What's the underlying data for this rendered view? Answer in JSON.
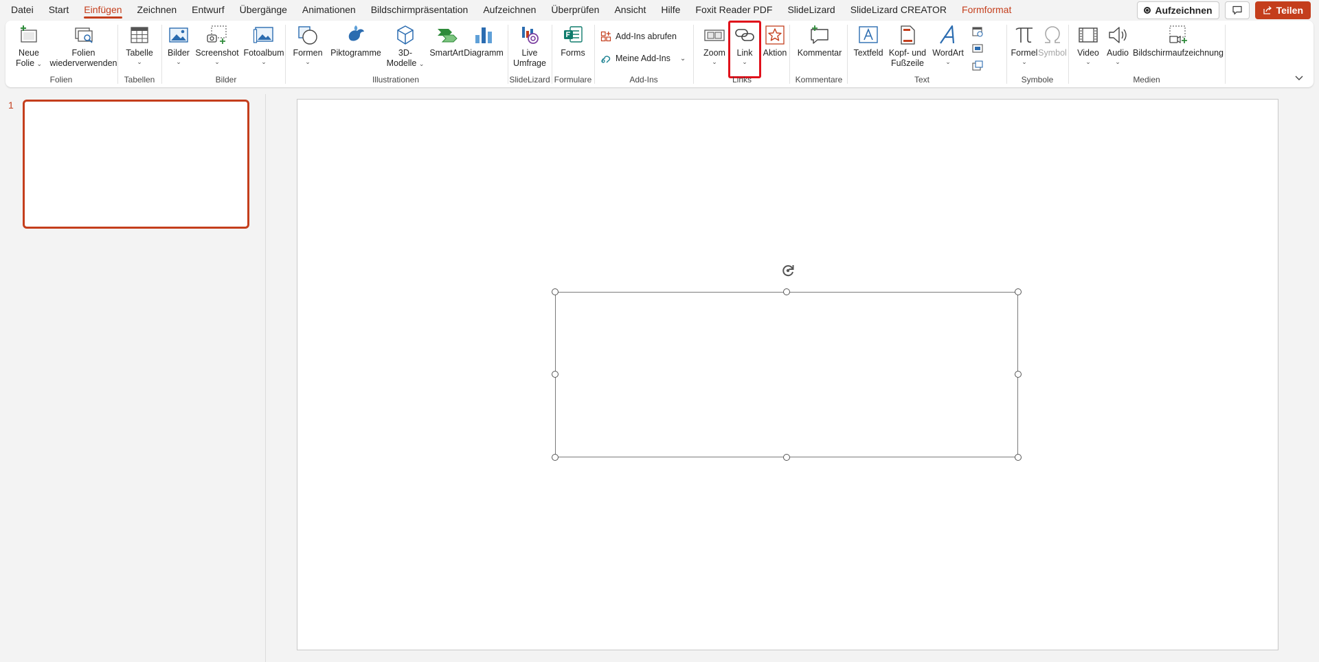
{
  "menu": {
    "tabs": [
      {
        "label": "Datei"
      },
      {
        "label": "Start"
      },
      {
        "label": "Einfügen"
      },
      {
        "label": "Zeichnen"
      },
      {
        "label": "Entwurf"
      },
      {
        "label": "Übergänge"
      },
      {
        "label": "Animationen"
      },
      {
        "label": "Bildschirmpräsentation"
      },
      {
        "label": "Aufzeichnen"
      },
      {
        "label": "Überprüfen"
      },
      {
        "label": "Ansicht"
      },
      {
        "label": "Hilfe"
      },
      {
        "label": "Foxit Reader PDF"
      },
      {
        "label": "SlideLizard"
      },
      {
        "label": "SlideLizard CREATOR"
      },
      {
        "label": "Formformat"
      }
    ],
    "active_tab": "Einfügen",
    "record_label": "Aufzeichnen",
    "share_label": "Teilen"
  },
  "ribbon": {
    "groups": {
      "folien": "Folien",
      "tabellen": "Tabellen",
      "bilder": "Bilder",
      "illustrationen": "Illustrationen",
      "slidelizard": "SlideLizard",
      "formulare": "Formulare",
      "addins": "Add-Ins",
      "links": "Links",
      "kommentare": "Kommentare",
      "text": "Text",
      "symbole": "Symbole",
      "medien": "Medien"
    },
    "buttons": {
      "neue_folie": [
        "Neue",
        "Folie"
      ],
      "folien_wiederverwenden": [
        "Folien",
        "wiederverwenden"
      ],
      "tabelle": "Tabelle",
      "bilder": "Bilder",
      "screenshot": "Screenshot",
      "fotoalbum": "Fotoalbum",
      "formen": "Formen",
      "piktogramme": "Piktogramme",
      "modelle_3d": [
        "3D-",
        "Modelle"
      ],
      "smartart": "SmartArt",
      "diagramm": "Diagramm",
      "live_umfrage": [
        "Live",
        "Umfrage"
      ],
      "forms": "Forms",
      "addins_abrufen": "Add-Ins abrufen",
      "meine_addins": "Meine Add-Ins",
      "zoom": "Zoom",
      "link": "Link",
      "aktion": "Aktion",
      "kommentar": "Kommentar",
      "textfeld": "Textfeld",
      "kopf_fusszeile": [
        "Kopf- und",
        "Fußzeile"
      ],
      "wordart": "WordArt",
      "formel": "Formel",
      "symbol": "Symbol",
      "video": "Video",
      "audio": "Audio",
      "bildschirmaufzeichnung": "Bildschirmaufzeichnung"
    }
  },
  "thumbnails": {
    "slides": [
      {
        "number": "1"
      }
    ]
  },
  "colors": {
    "accent": "#c43e1c",
    "highlight": "#e0111b"
  }
}
